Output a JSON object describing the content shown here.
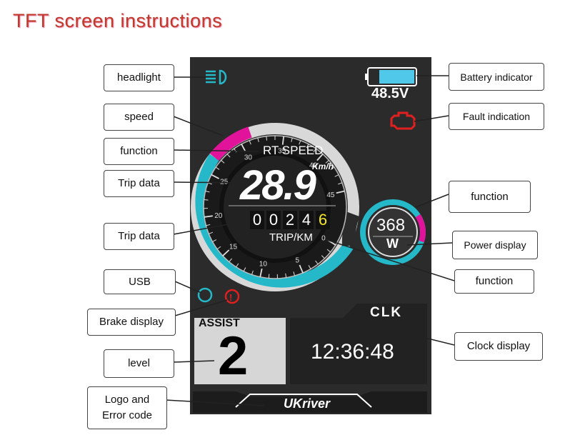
{
  "title": "TFT screen instructions",
  "screen": {
    "voltage": "48.5V",
    "mode_label": "RT SPEED",
    "speed": "28.9",
    "speed_unit": "Km/h",
    "trip_digits": [
      "0",
      "0",
      "2",
      "4",
      "6"
    ],
    "trip_label": "TRIP/KM",
    "power": "368",
    "power_unit": "W",
    "assist_label": "ASSIST",
    "assist_level": "2",
    "clock_label": "CLK",
    "clock": "12:36:48",
    "logo": "UKriver",
    "gauge_ticks": [
      "0",
      "5",
      "10",
      "15",
      "20",
      "25",
      "30",
      "35",
      "40",
      "45"
    ],
    "battery_level": 0.75,
    "colors": {
      "accent": "#25b8c8",
      "warn": "#e0139a",
      "fault": "#e02020",
      "bg": "#2b2b2b"
    }
  },
  "callouts": {
    "headlight": "headlight",
    "speed": "speed",
    "function1": "function",
    "trip1": "Trip data",
    "trip2": "Trip data",
    "usb": "USB",
    "brake": "Brake display",
    "level": "level",
    "logo1": "Logo and",
    "logo2": "Error code",
    "battery": "Battery indicator",
    "fault": "Fault indication",
    "function2": "function",
    "power": "Power display",
    "function3": "function",
    "clock": "Clock display"
  }
}
